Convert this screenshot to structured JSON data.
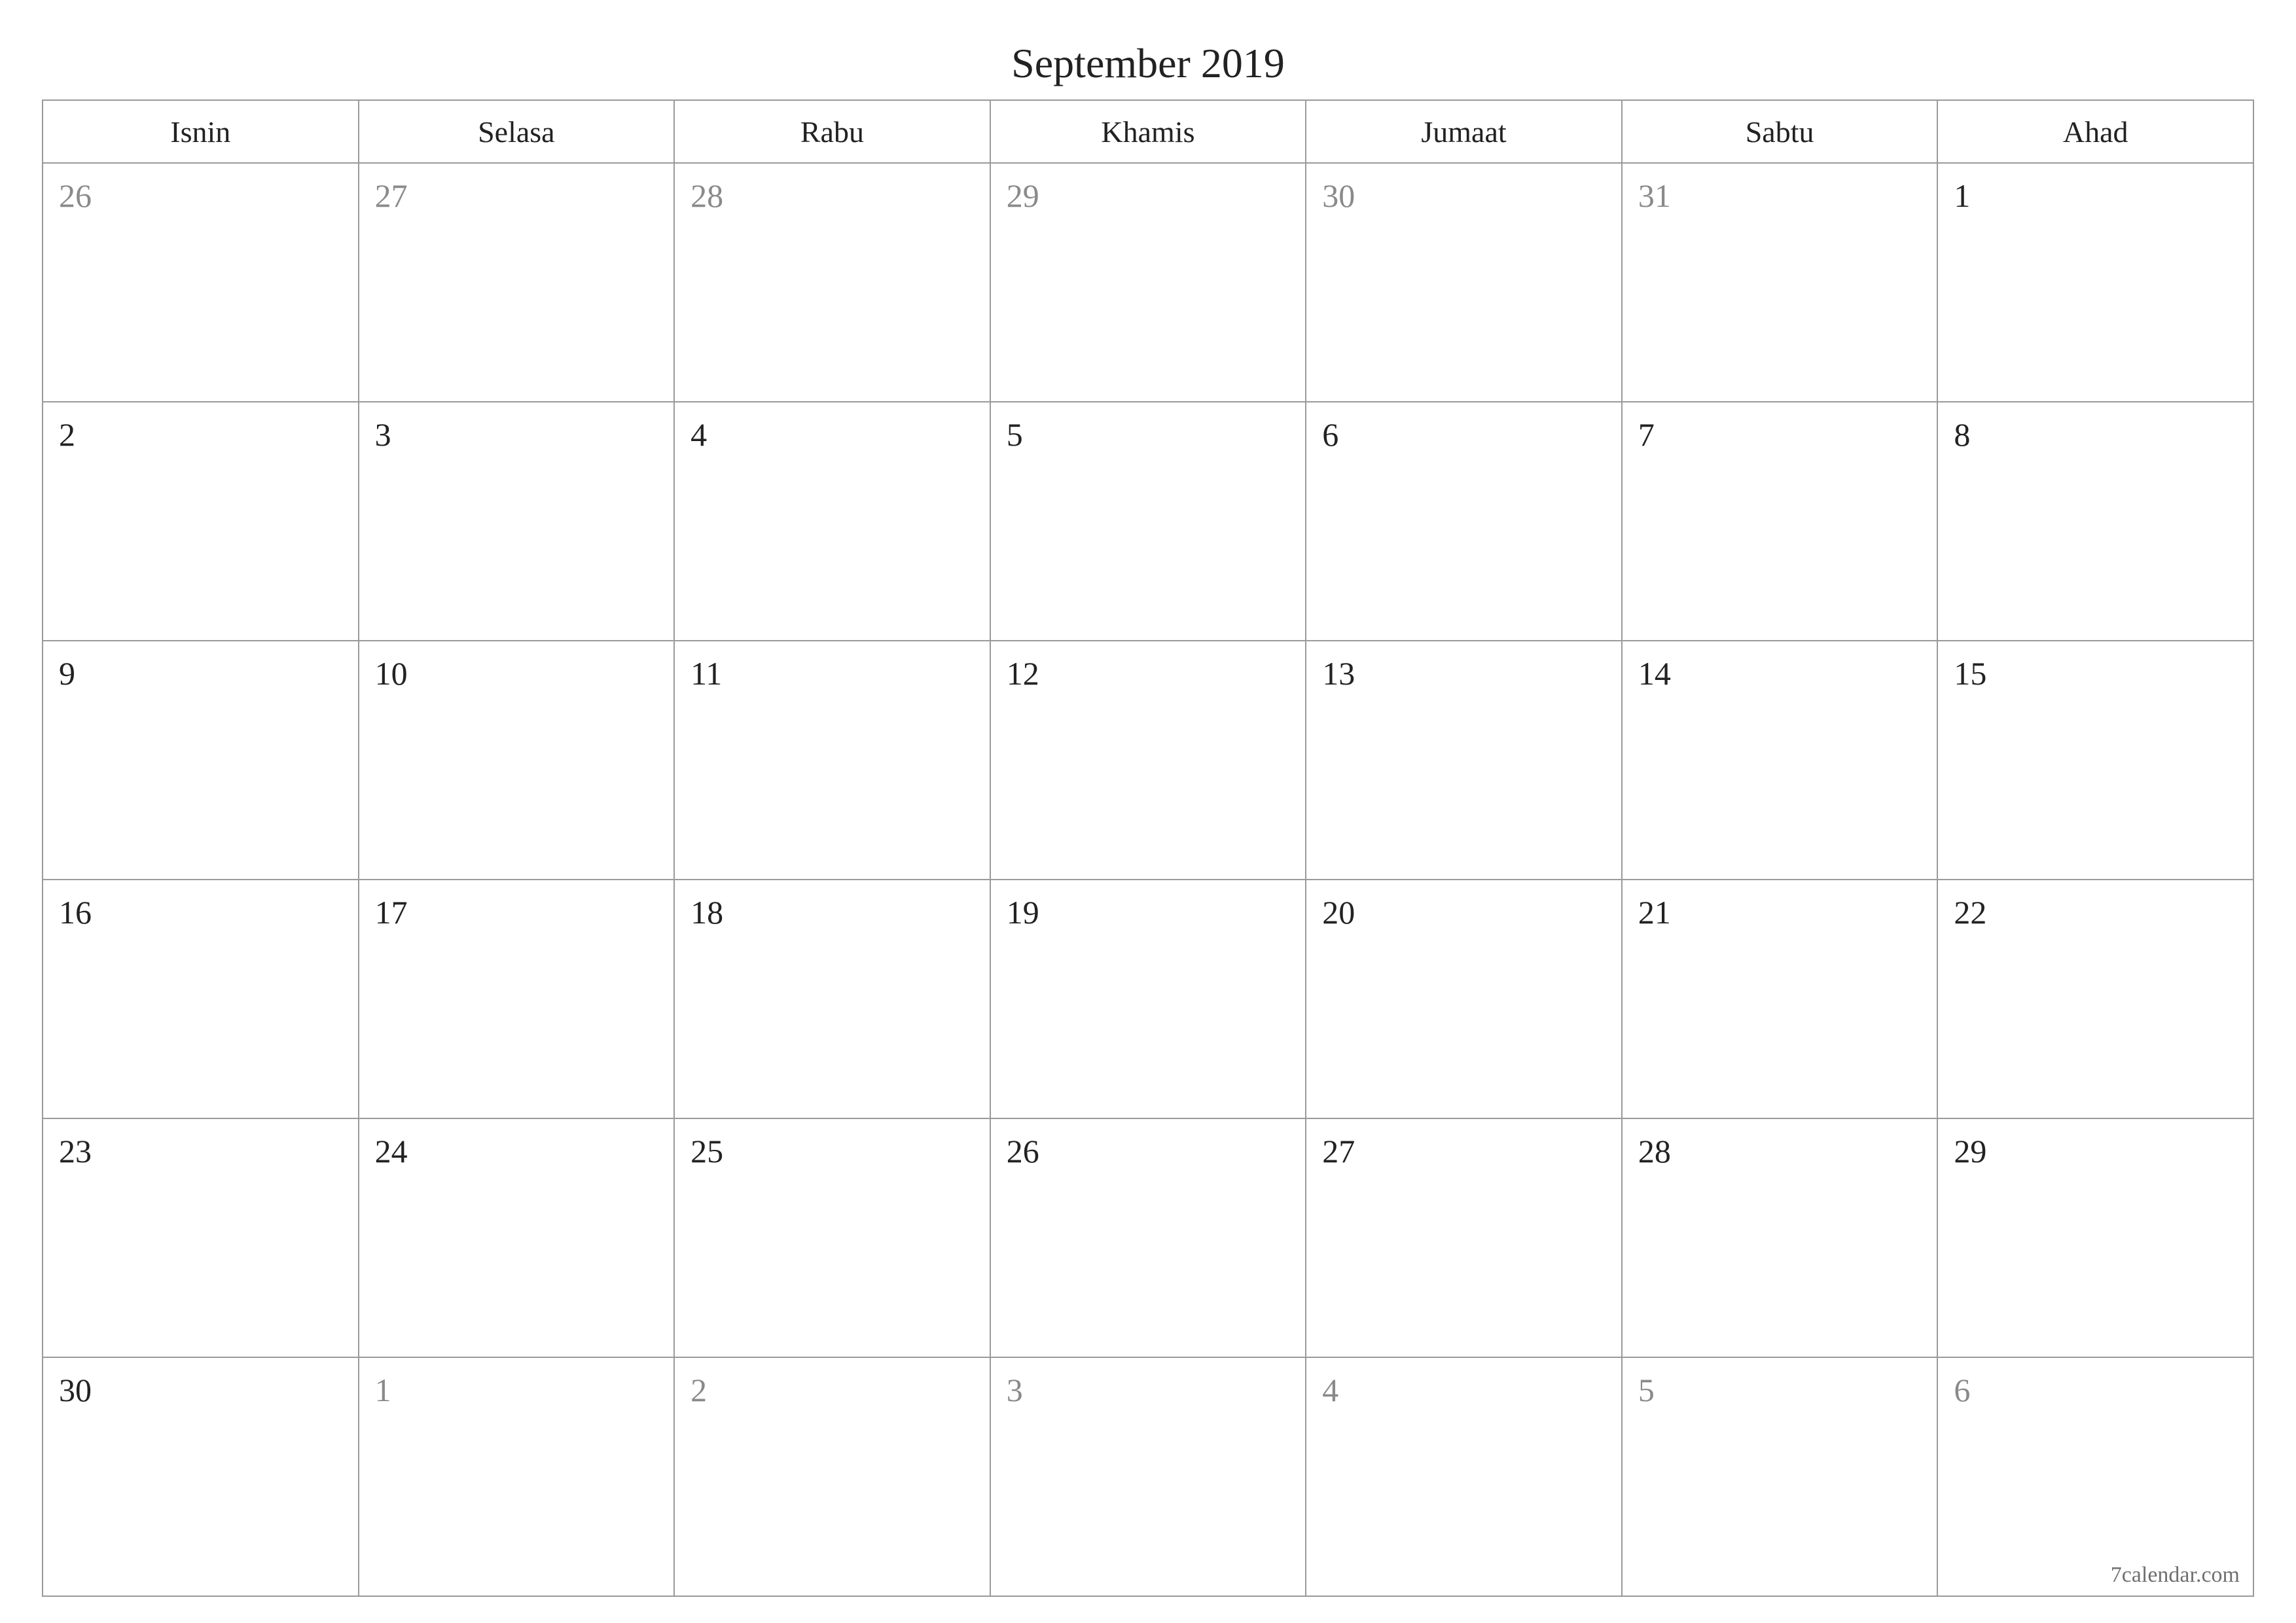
{
  "title": "September 2019",
  "footer": "7calendar.com",
  "weekdays": [
    "Isnin",
    "Selasa",
    "Rabu",
    "Khamis",
    "Jumaat",
    "Sabtu",
    "Ahad"
  ],
  "weeks": [
    [
      {
        "day": "26",
        "other": true
      },
      {
        "day": "27",
        "other": true
      },
      {
        "day": "28",
        "other": true
      },
      {
        "day": "29",
        "other": true
      },
      {
        "day": "30",
        "other": true
      },
      {
        "day": "31",
        "other": true
      },
      {
        "day": "1",
        "other": false
      }
    ],
    [
      {
        "day": "2",
        "other": false
      },
      {
        "day": "3",
        "other": false
      },
      {
        "day": "4",
        "other": false
      },
      {
        "day": "5",
        "other": false
      },
      {
        "day": "6",
        "other": false
      },
      {
        "day": "7",
        "other": false
      },
      {
        "day": "8",
        "other": false
      }
    ],
    [
      {
        "day": "9",
        "other": false
      },
      {
        "day": "10",
        "other": false
      },
      {
        "day": "11",
        "other": false
      },
      {
        "day": "12",
        "other": false
      },
      {
        "day": "13",
        "other": false
      },
      {
        "day": "14",
        "other": false
      },
      {
        "day": "15",
        "other": false
      }
    ],
    [
      {
        "day": "16",
        "other": false
      },
      {
        "day": "17",
        "other": false
      },
      {
        "day": "18",
        "other": false
      },
      {
        "day": "19",
        "other": false
      },
      {
        "day": "20",
        "other": false
      },
      {
        "day": "21",
        "other": false
      },
      {
        "day": "22",
        "other": false
      }
    ],
    [
      {
        "day": "23",
        "other": false
      },
      {
        "day": "24",
        "other": false
      },
      {
        "day": "25",
        "other": false
      },
      {
        "day": "26",
        "other": false
      },
      {
        "day": "27",
        "other": false
      },
      {
        "day": "28",
        "other": false
      },
      {
        "day": "29",
        "other": false
      }
    ],
    [
      {
        "day": "30",
        "other": false
      },
      {
        "day": "1",
        "other": true
      },
      {
        "day": "2",
        "other": true
      },
      {
        "day": "3",
        "other": true
      },
      {
        "day": "4",
        "other": true
      },
      {
        "day": "5",
        "other": true
      },
      {
        "day": "6",
        "other": true
      }
    ]
  ]
}
